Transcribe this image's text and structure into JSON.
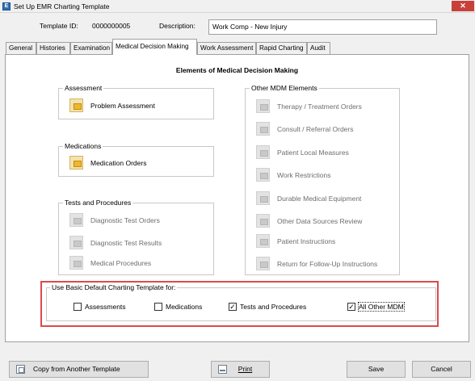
{
  "window": {
    "title": "Set Up EMR Charting Template",
    "close_glyph": "✕",
    "icon_glyph": "E"
  },
  "header": {
    "template_id_label": "Template ID:",
    "template_id_value": "0000000005",
    "description_label": "Description:",
    "description_value": "Work Comp - New Injury"
  },
  "tabs": [
    {
      "label": "General",
      "active": false
    },
    {
      "label": "Histories",
      "active": false
    },
    {
      "label": "Examination",
      "active": false
    },
    {
      "label": "Medical Decision Making",
      "active": true
    },
    {
      "label": "Work Assessment",
      "active": false
    },
    {
      "label": "Rapid Charting",
      "active": false
    },
    {
      "label": "Audit",
      "active": false
    }
  ],
  "panel": {
    "heading": "Elements of Medical Decision Making",
    "assessment": {
      "label": "Assessment",
      "items": [
        {
          "label": "Problem Assessment",
          "enabled": true
        }
      ]
    },
    "medications": {
      "label": "Medications",
      "items": [
        {
          "label": "Medication Orders",
          "enabled": true
        }
      ]
    },
    "tests": {
      "label": "Tests and Procedures",
      "items": [
        {
          "label": "Diagnostic Test Orders",
          "enabled": false
        },
        {
          "label": "Diagnostic Test Results",
          "enabled": false
        },
        {
          "label": "Medical Procedures",
          "enabled": false
        }
      ]
    },
    "other": {
      "label": "Other MDM Elements",
      "items": [
        {
          "label": "Therapy / Treatment Orders",
          "enabled": false
        },
        {
          "label": "Consult / Referral Orders",
          "enabled": false
        },
        {
          "label": "Patient Local Measures",
          "enabled": false
        },
        {
          "label": "Work Restrictions",
          "enabled": false
        },
        {
          "label": "Durable Medical Equipment",
          "enabled": false
        },
        {
          "label": "Other Data Sources Review",
          "enabled": false
        },
        {
          "label": "Patient Instructions",
          "enabled": false
        },
        {
          "label": "Return for Follow-Up Instructions",
          "enabled": false
        }
      ]
    },
    "basic_default": {
      "label": "Use Basic Default Charting Template for:",
      "options": [
        {
          "label": "Assessments",
          "checked": false
        },
        {
          "label": "Medications",
          "checked": false
        },
        {
          "label": "Tests and Procedures",
          "checked": true
        },
        {
          "label": "All Other MDM",
          "checked": true
        }
      ],
      "highlight_color": "#dd4a4a"
    }
  },
  "footer": {
    "copy_label": "Copy from Another Template",
    "print_label": "Print",
    "save_label": "Save",
    "cancel_label": "Cancel"
  },
  "check_glyph": "✓"
}
